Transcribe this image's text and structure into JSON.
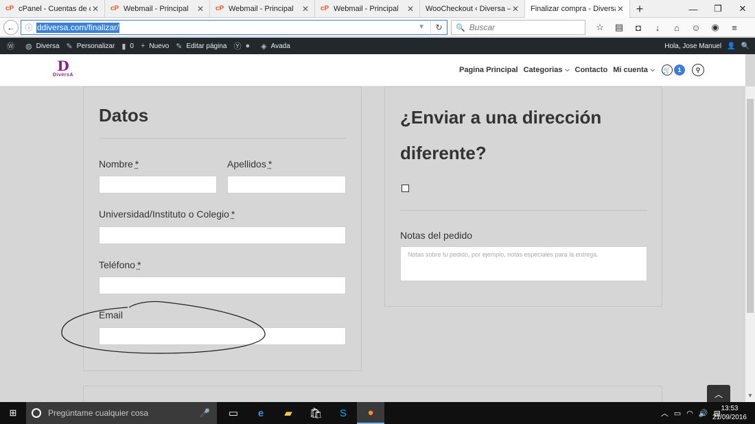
{
  "browser": {
    "tabs": [
      {
        "icon": "cpanel-icon",
        "label": "cPanel - Cuentas de c...",
        "active": false
      },
      {
        "icon": "cpanel-icon",
        "label": "Webmail - Principal",
        "active": false
      },
      {
        "icon": "cpanel-icon",
        "label": "Webmail - Principal",
        "active": false
      },
      {
        "icon": "cpanel-icon",
        "label": "Webmail - Principal",
        "active": false
      },
      {
        "icon": "",
        "label": "WooCheckout ‹ Diversa —...",
        "active": false
      },
      {
        "icon": "",
        "label": "Finalizar compra - Diversa",
        "active": true
      }
    ],
    "url": "ddiversa.com/finalizar/",
    "search_placeholder": "Buscar"
  },
  "adminbar": {
    "site": "Diversa",
    "customize": "Personalizar",
    "comments": "0",
    "new": "Nuevo",
    "edit": "Editar página",
    "avada": "Avada",
    "greeting": "Hola, Jose Manuel"
  },
  "header": {
    "logo_letter": "D",
    "logo_text": "DiversA",
    "nav": [
      "Pagina Principal",
      "Categorias",
      "Contacto",
      "Mi cuenta"
    ],
    "cart_count": "1"
  },
  "billing": {
    "title": "Datos",
    "required_mark": "*",
    "first_name_label": "Nombre",
    "last_name_label": "Apellidos",
    "school_label": "Universidad/Instituto o Colegio",
    "phone_label": "Teléfono",
    "email_label": "Email"
  },
  "shipping": {
    "title": "¿Enviar a una dirección diferente?",
    "notes_label": "Notas del pedido",
    "notes_placeholder": "Notas sobre tu pedido, por ejemplo, notas especiales para la entrega."
  },
  "taskbar": {
    "search_placeholder": "Pregúntame cualquier cosa",
    "time": "13:53",
    "date": "21/09/2016"
  }
}
